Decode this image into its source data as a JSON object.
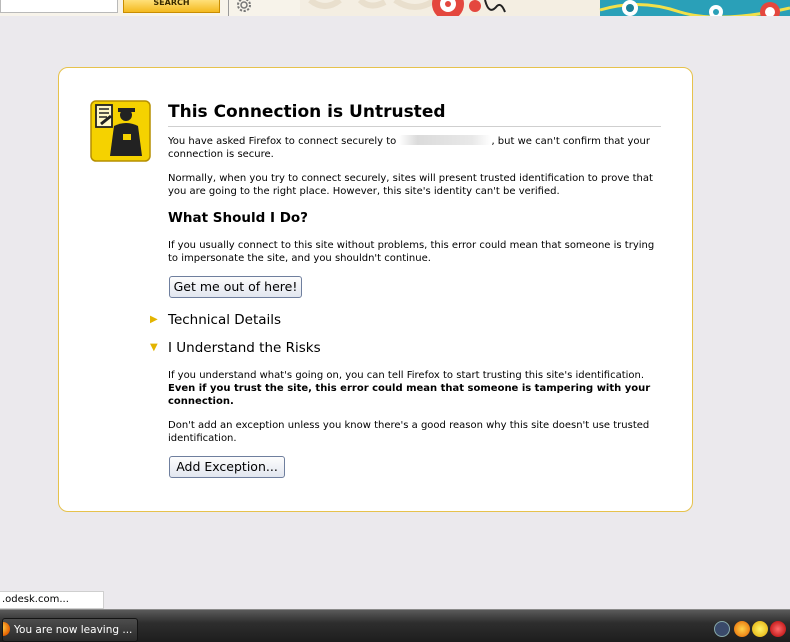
{
  "toolbar": {
    "search_label": "SEARCH"
  },
  "error_page": {
    "title": "This Connection is Untrusted",
    "intro_before": "You have asked Firefox to connect securely to ",
    "intro_after": ", but we can't confirm that your connection is secure.",
    "normally": "Normally, when you try to connect securely, sites will present trusted identification to prove that you are going to the right place. However, this site's identity can't be verified.",
    "what_heading": "What Should I Do?",
    "what_text": "If you usually connect to this site without problems, this error could mean that someone is trying to impersonate the site, and you shouldn't continue.",
    "get_out_button": "Get me out of here!",
    "technical_details": "Technical Details",
    "understand_risks": "I Understand the Risks",
    "risks_text": "If you understand what's going on, you can tell Firefox to start trusting this site's identification. ",
    "risks_bold": "Even if you trust the site, this error could mean that someone is tampering with your connection.",
    "exception_note": "Don't add an exception unless you know there's a good reason why this site doesn't use trusted identification.",
    "add_exception_button": "Add Exception..."
  },
  "status": {
    "text": ".odesk.com..."
  },
  "taskbar": {
    "task_label": "You are now leaving ..."
  },
  "icons": {
    "certificate": "sheriff-badge-icon",
    "gear": "gear-icon",
    "browser": "firefox-icon"
  },
  "colors": {
    "accent_yellow": "#f5d200",
    "box_border": "#e6c24c",
    "arrow": "#e3b400"
  }
}
